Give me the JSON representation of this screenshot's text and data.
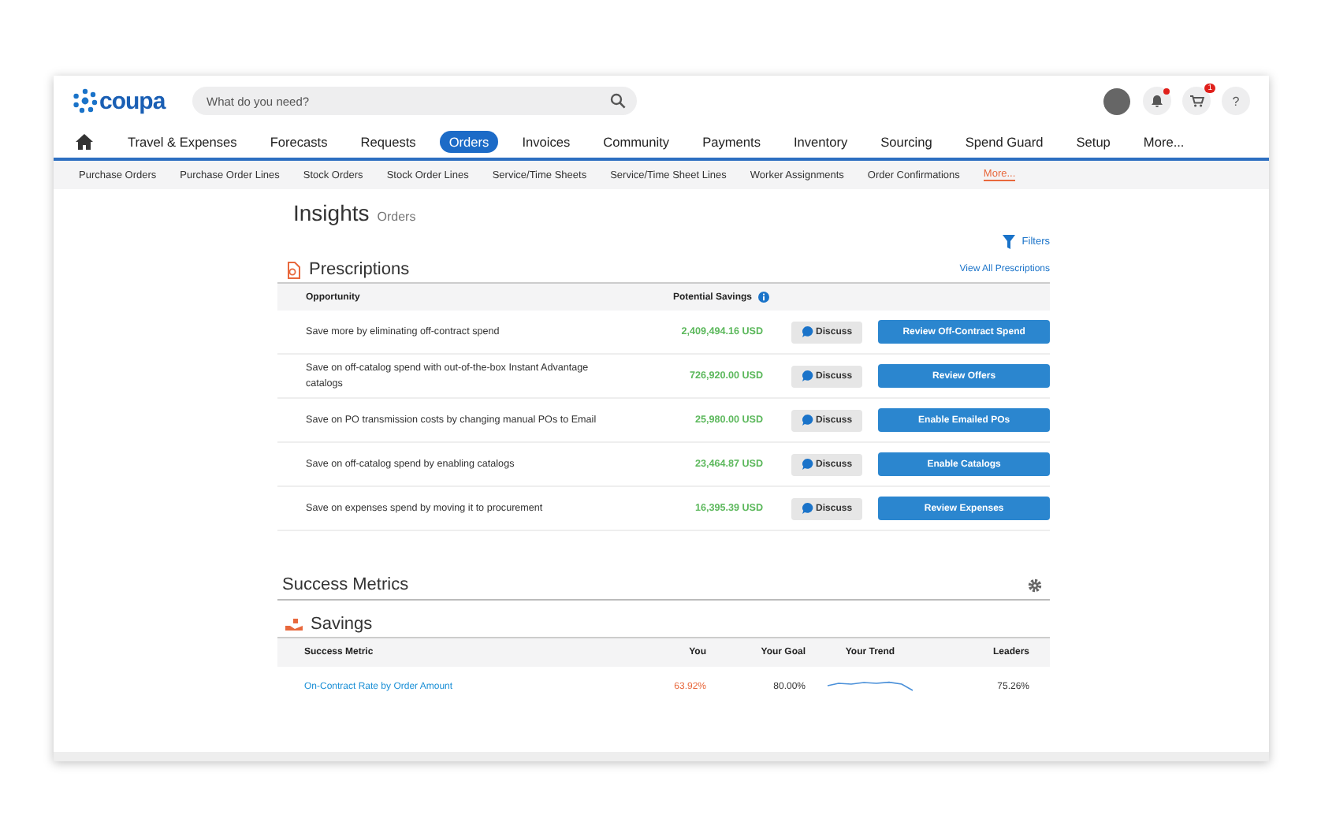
{
  "header": {
    "logo": "coupa",
    "search": {
      "placeholder": "What do you need?"
    },
    "notification_dot": true,
    "cart_badge": "1",
    "help": "?"
  },
  "nav": {
    "items": [
      {
        "label": "Travel & Expenses",
        "selected": false
      },
      {
        "label": "Forecasts",
        "selected": false
      },
      {
        "label": "Requests",
        "selected": false
      },
      {
        "label": "Orders",
        "selected": true
      },
      {
        "label": "Invoices",
        "selected": false
      },
      {
        "label": "Community",
        "selected": false
      },
      {
        "label": "Payments",
        "selected": false
      },
      {
        "label": "Inventory",
        "selected": false
      },
      {
        "label": "Sourcing",
        "selected": false
      },
      {
        "label": "Spend Guard",
        "selected": false
      },
      {
        "label": "Setup",
        "selected": false
      },
      {
        "label": "More...",
        "selected": false
      }
    ]
  },
  "subnav": {
    "items": [
      {
        "label": "Purchase Orders",
        "kind": "tab"
      },
      {
        "label": "Purchase Order Lines",
        "kind": "tab"
      },
      {
        "label": "Stock Orders",
        "kind": "tab"
      },
      {
        "label": "Stock Order Lines",
        "kind": "tab"
      },
      {
        "label": "Service/Time Sheets",
        "kind": "tab"
      },
      {
        "label": "Service/Time Sheet Lines",
        "kind": "tab"
      },
      {
        "label": "Worker Assignments",
        "kind": "tab"
      },
      {
        "label": "Order Confirmations",
        "kind": "tab"
      },
      {
        "label": "More...",
        "kind": "more"
      }
    ]
  },
  "page": {
    "title": "Insights",
    "subtitle": "Orders",
    "filters": "Filters"
  },
  "prescriptions": {
    "title": "Prescriptions",
    "view_all": "View All Prescriptions",
    "columns": [
      "Opportunity",
      "Potential Savings"
    ],
    "rows": [
      {
        "opportunity": "Save more by eliminating off-contract spend",
        "savings": "2,409,494.16 USD",
        "discuss": "Discuss",
        "action": "Review Off-Contract Spend"
      },
      {
        "opportunity": "Save on off-catalog spend with out-of-the-box Instant Advantage catalogs",
        "savings": "726,920.00 USD",
        "discuss": "Discuss",
        "action": "Review Offers"
      },
      {
        "opportunity": "Save on PO transmission costs by changing manual POs to Email",
        "savings": "25,980.00 USD",
        "discuss": "Discuss",
        "action": "Enable Emailed POs"
      },
      {
        "opportunity": "Save on off-catalog spend by enabling catalogs",
        "savings": "23,464.87 USD",
        "discuss": "Discuss",
        "action": "Enable Catalogs"
      },
      {
        "opportunity": "Save on expenses spend by moving it to procurement",
        "savings": "16,395.39 USD",
        "discuss": "Discuss",
        "action": "Review Expenses"
      }
    ]
  },
  "success_metrics": {
    "title": "Success Metrics",
    "savings": {
      "title": "Savings",
      "columns": [
        "Success Metric",
        "You",
        "Your Goal",
        "Your Trend",
        "Leaders"
      ],
      "rows": [
        {
          "metric": "On-Contract Rate by Order Amount",
          "you": "63.92%",
          "goal": "80.00%",
          "leaders": "75.26%"
        }
      ]
    }
  }
}
